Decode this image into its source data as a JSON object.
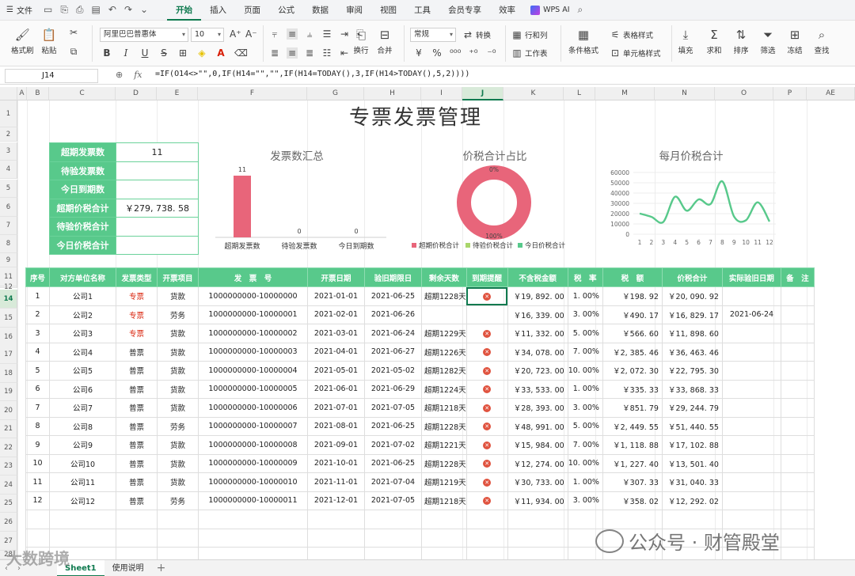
{
  "menubar": {
    "file": "文件",
    "tabs": [
      "开始",
      "插入",
      "页面",
      "公式",
      "数据",
      "审阅",
      "视图",
      "工具",
      "会员专享",
      "效率"
    ],
    "ai": "WPS AI"
  },
  "ribbon": {
    "format_painter": "格式刷",
    "paste": "粘贴",
    "font_name": "阿里巴巴普惠体",
    "font_size": "10",
    "wrap": "换行",
    "merge": "合并",
    "number_format": "常规",
    "convert": "转换",
    "row_col": "行和列",
    "worksheet": "工作表",
    "cond_format": "条件格式",
    "table_style": "表格样式",
    "cell_style": "单元格样式",
    "fill": "填充",
    "sum": "求和",
    "sort": "排序",
    "filter": "筛选",
    "freeze": "冻结",
    "find": "查找"
  },
  "formula_bar": {
    "cell_ref": "J14",
    "formula": "=IF(O14<>\"\",0,IF(H14=\"\",\"\",IF(H14=TODAY(),3,IF(H14>TODAY(),5,2))))"
  },
  "columns": [
    "A",
    "B",
    "C",
    "D",
    "E",
    "F",
    "G",
    "H",
    "I",
    "J",
    "K",
    "L",
    "M",
    "N",
    "O",
    "P",
    "AE"
  ],
  "rows": [
    "1",
    "2",
    "3",
    "4",
    "5",
    "6",
    "7",
    "8",
    "9",
    "11",
    "12",
    "14",
    "15",
    "16",
    "17",
    "18",
    "19",
    "20",
    "21",
    "22",
    "23",
    "24",
    "25",
    "26",
    "27",
    "28"
  ],
  "title": "专票发票管理",
  "summary": [
    {
      "label": "超期发票数",
      "value": "11"
    },
    {
      "label": "待验发票数",
      "value": ""
    },
    {
      "label": "今日到期数",
      "value": ""
    },
    {
      "label": "超期价税合计",
      "value": "￥279, 738. 58"
    },
    {
      "label": "待验价税合计",
      "value": ""
    },
    {
      "label": "今日价税合计",
      "value": ""
    }
  ],
  "chart_data": [
    {
      "type": "bar",
      "title": "发票数汇总",
      "categories": [
        "超期发票数",
        "待验发票数",
        "今日到期数"
      ],
      "values": [
        11,
        0,
        0
      ],
      "color": "#e8657a"
    },
    {
      "type": "pie",
      "title": "价税合计占比",
      "labels": [
        "超期价税合计",
        "待验价税合计",
        "今日价税合计"
      ],
      "values": [
        100,
        0,
        0
      ],
      "data_labels": [
        "100%",
        "0%"
      ],
      "colors": [
        "#e8657a",
        "#a9d66b",
        "#58c98b"
      ],
      "legend": "bottom"
    },
    {
      "type": "line",
      "title": "每月价税合计",
      "x": [
        1,
        2,
        3,
        4,
        5,
        6,
        7,
        8,
        9,
        10,
        11,
        12
      ],
      "values": [
        20090.92,
        16829.17,
        11898.6,
        36463.46,
        22795.3,
        33868.33,
        29244.79,
        51440.55,
        17102.88,
        13501.4,
        31040.33,
        12292.02
      ],
      "yticks": [
        0,
        10000,
        20000,
        30000,
        40000,
        50000,
        60000
      ],
      "ylim": [
        0,
        60000
      ],
      "color": "#58c98b"
    }
  ],
  "table": {
    "headers": [
      "序号",
      "对方单位名称",
      "发票类型",
      "开票项目",
      "发　票　号",
      "开票日期",
      "验旧期限日",
      "剩余天数",
      "到期提醒",
      "不含税金额",
      "税　率",
      "税　额",
      "价税合计",
      "实际验旧日期",
      "备　注"
    ],
    "rows": [
      [
        "1",
        "公司1",
        "专票",
        "货款",
        "1000000000-10000000",
        "2021-01-01",
        "2021-06-25",
        "超期1228天",
        "x",
        "￥19, 892. 00",
        "1. 00%",
        "￥198. 92",
        "￥20, 090. 92",
        ""
      ],
      [
        "2",
        "公司2",
        "专票",
        "劳务",
        "1000000000-10000001",
        "2021-02-01",
        "2021-06-26",
        "",
        "",
        "￥16, 339. 00",
        "3. 00%",
        "￥490. 17",
        "￥16, 829. 17",
        "2021-06-24"
      ],
      [
        "3",
        "公司3",
        "专票",
        "货款",
        "1000000000-10000002",
        "2021-03-01",
        "2021-06-24",
        "超期1229天",
        "x",
        "￥11, 332. 00",
        "5. 00%",
        "￥566. 60",
        "￥11, 898. 60",
        ""
      ],
      [
        "4",
        "公司4",
        "普票",
        "货款",
        "1000000000-10000003",
        "2021-04-01",
        "2021-06-27",
        "超期1226天",
        "x",
        "￥34, 078. 00",
        "7. 00%",
        "￥2, 385. 46",
        "￥36, 463. 46",
        ""
      ],
      [
        "5",
        "公司5",
        "普票",
        "货款",
        "1000000000-10000004",
        "2021-05-01",
        "2021-05-02",
        "超期1282天",
        "x",
        "￥20, 723. 00",
        "10. 00%",
        "￥2, 072. 30",
        "￥22, 795. 30",
        ""
      ],
      [
        "6",
        "公司6",
        "普票",
        "货款",
        "1000000000-10000005",
        "2021-06-01",
        "2021-06-29",
        "超期1224天",
        "x",
        "￥33, 533. 00",
        "1. 00%",
        "￥335. 33",
        "￥33, 868. 33",
        ""
      ],
      [
        "7",
        "公司7",
        "普票",
        "货款",
        "1000000000-10000006",
        "2021-07-01",
        "2021-07-05",
        "超期1218天",
        "x",
        "￥28, 393. 00",
        "3. 00%",
        "￥851. 79",
        "￥29, 244. 79",
        ""
      ],
      [
        "8",
        "公司8",
        "普票",
        "劳务",
        "1000000000-10000007",
        "2021-08-01",
        "2021-06-25",
        "超期1228天",
        "x",
        "￥48, 991. 00",
        "5. 00%",
        "￥2, 449. 55",
        "￥51, 440. 55",
        ""
      ],
      [
        "9",
        "公司9",
        "普票",
        "货款",
        "1000000000-10000008",
        "2021-09-01",
        "2021-07-02",
        "超期1221天",
        "x",
        "￥15, 984. 00",
        "7. 00%",
        "￥1, 118. 88",
        "￥17, 102. 88",
        ""
      ],
      [
        "10",
        "公司10",
        "普票",
        "货款",
        "1000000000-10000009",
        "2021-10-01",
        "2021-06-25",
        "超期1228天",
        "x",
        "￥12, 274. 00",
        "10. 00%",
        "￥1, 227. 40",
        "￥13, 501. 40",
        ""
      ],
      [
        "11",
        "公司11",
        "普票",
        "货款",
        "1000000000-10000010",
        "2021-11-01",
        "2021-07-04",
        "超期1219天",
        "x",
        "￥30, 733. 00",
        "1. 00%",
        "￥307. 33",
        "￥31, 040. 33",
        ""
      ],
      [
        "12",
        "公司12",
        "普票",
        "劳务",
        "1000000000-10000011",
        "2021-12-01",
        "2021-07-05",
        "超期1218天",
        "x",
        "￥11, 934. 00",
        "3. 00%",
        "￥358. 02",
        "￥12, 292. 02",
        ""
      ]
    ]
  },
  "sheets": [
    "Sheet1",
    "使用说明"
  ],
  "watermark": "公众号 · 财管殿堂",
  "watermark2": "大数跨境"
}
